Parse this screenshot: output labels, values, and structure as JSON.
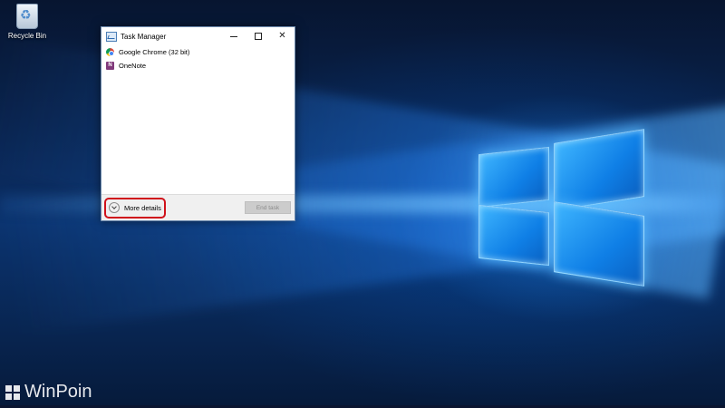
{
  "desktop": {
    "icons": [
      {
        "label": "Recycle Bin",
        "icon": "recycle-bin-icon"
      }
    ],
    "watermark": {
      "text": "WinPoin",
      "icon": "windows-logo-icon"
    },
    "accent_color": "#1a8cff"
  },
  "task_manager": {
    "title": "Task Manager",
    "window_controls": {
      "minimize": "minimize-icon",
      "maximize": "maximize-icon",
      "close": "close-icon"
    },
    "processes": [
      {
        "name": "Google Chrome (32 bit)",
        "icon": "chrome-icon"
      },
      {
        "name": "OneNote",
        "icon": "onenote-icon"
      }
    ],
    "more_details_label": "More details",
    "end_task_label": "End task",
    "highlight_color": "#d0121b"
  }
}
